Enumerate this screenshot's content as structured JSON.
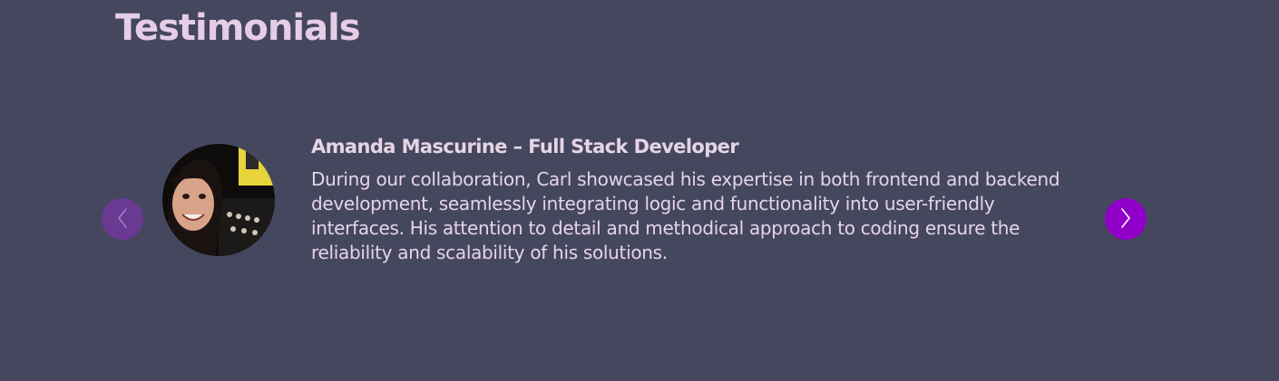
{
  "section": {
    "title": "Testimonials"
  },
  "carousel": {
    "prev_icon": "chevron-left-icon",
    "next_icon": "chevron-right-icon",
    "active_index": 0
  },
  "testimonials": [
    {
      "author": "Amanda Mascurine – Full Stack Developer",
      "text": "During our collaboration, Carl showcased his expertise in both frontend and backend development, seamlessly integrating logic and functionality into user-friendly interfaces. His attention to detail and methodical approach to coding ensure the reliability and scalability of his solutions."
    }
  ],
  "colors": {
    "background": "#45475e",
    "heading": "#e6cde6",
    "text": "#e6d5e6",
    "prev_button": "#6a3a93",
    "next_button": "#9000c8"
  }
}
